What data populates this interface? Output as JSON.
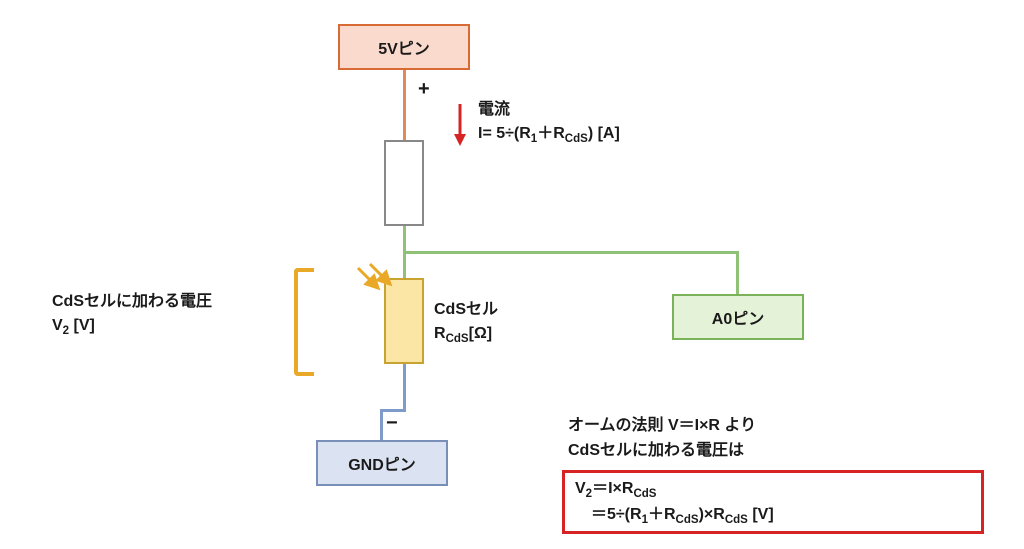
{
  "pins": {
    "v5": "5Vピン",
    "a0": "A0ピン",
    "gnd": "GNDピン"
  },
  "signs": {
    "plus": "+",
    "minus": "−"
  },
  "components": {
    "cds_label_line1": "CdSセル",
    "cds_r_prefix": "R",
    "cds_r_sub": "CdS",
    "cds_r_unit": "[Ω]"
  },
  "current": {
    "title": "電流",
    "eq_left": "I= 5÷(R",
    "sub1": "1",
    "mid": "＋R",
    "sub2": "CdS",
    "right": ") [A]"
  },
  "voltage_label": {
    "line1": "CdSセルに加わる電圧",
    "line2_prefix": "V",
    "line2_sub": "2",
    "line2_unit": " [V]"
  },
  "law_intro": {
    "line1": "オームの法則 V＝I×R より",
    "line2": "CdSセルに加わる電圧は"
  },
  "law_eq": {
    "l1_a": "V",
    "l1_sub1": "2",
    "l1_b": "＝I×R",
    "l1_sub2": "CdS",
    "l2_a": "　＝5÷(R",
    "l2_sub1": "1",
    "l2_b": "＋R",
    "l2_sub2": "CdS",
    "l2_c": ")×R",
    "l2_sub3": "CdS",
    "l2_d": " [V]"
  },
  "colors": {
    "wire_orange": "#e08a56",
    "wire_green": "#8fc276",
    "wire_blue": "#7e9bc9",
    "arrow_red": "#d62323",
    "arrow_orange": "#e9a826"
  }
}
